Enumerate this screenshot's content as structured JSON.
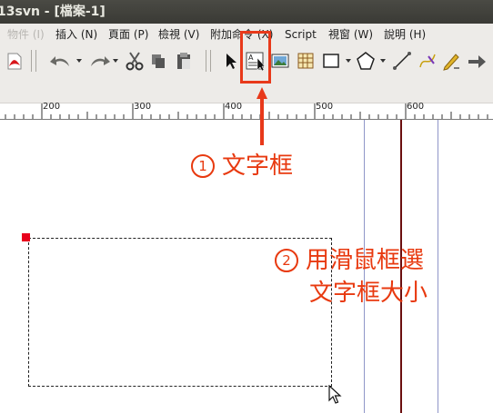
{
  "window": {
    "title": "13svn - [檔案-1]"
  },
  "menu": {
    "items": [
      {
        "label": "物件 (I)",
        "disabled": true
      },
      {
        "label": "插入 (N)"
      },
      {
        "label": "頁面 (P)"
      },
      {
        "label": "檢視 (V)"
      },
      {
        "label": "附加命令 (X)"
      },
      {
        "label": "Script"
      },
      {
        "label": "視窗 (W)"
      },
      {
        "label": "說明 (H)"
      }
    ]
  },
  "ruler": {
    "labels": [
      "200",
      "300",
      "400",
      "500",
      "600"
    ]
  },
  "annotations": {
    "step1": {
      "number": "1",
      "text": "文字框"
    },
    "step2": {
      "number": "2",
      "line1": "用滑鼠框選",
      "line2": "文字框大小"
    }
  },
  "colors": {
    "annotation": "#e8390f",
    "guide_dark": "#6b0f0f",
    "guide_light": "#8f96c8",
    "handle": "#e8001c"
  },
  "icons": [
    "pdf-export-icon",
    "undo-icon",
    "redo-icon",
    "cut-icon",
    "copy-icon",
    "paste-icon",
    "select-arrow-icon",
    "text-frame-icon",
    "image-frame-icon",
    "table-icon",
    "rectangle-icon",
    "polygon-icon",
    "line-icon",
    "bezier-icon",
    "freehand-icon",
    "rotate-icon"
  ]
}
